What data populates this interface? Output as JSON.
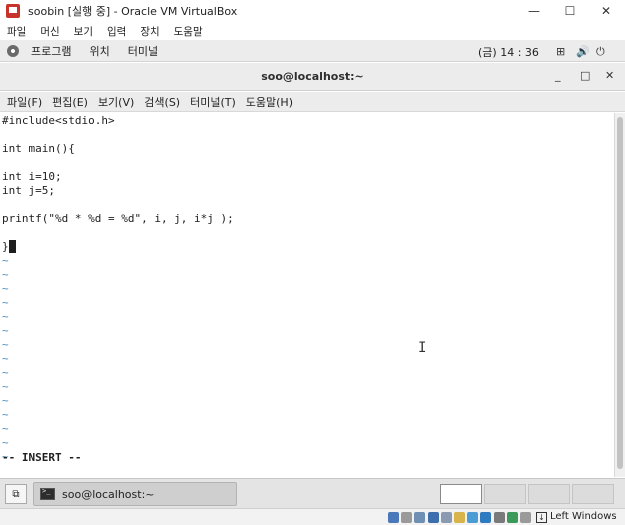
{
  "vbox": {
    "window_title": "soobin [실행 중] - Oracle VM VirtualBox",
    "minimize_glyph": "—",
    "maximize_glyph": "☐",
    "close_glyph": "✕",
    "menu": [
      "파일",
      "머신",
      "보기",
      "입력",
      "장치",
      "도움말"
    ],
    "host_key_label": "Left Windows",
    "status_icons": [
      {
        "name": "hard-disk-icon",
        "color": "#4a78b8"
      },
      {
        "name": "optical-drive-icon",
        "color": "#9a9a9a"
      },
      {
        "name": "audio-icon",
        "color": "#6f8fb3"
      },
      {
        "name": "network-icon",
        "color": "#3d6fae"
      },
      {
        "name": "usb-icon",
        "color": "#8a9ab0"
      },
      {
        "name": "shared-folders-icon",
        "color": "#d8b44a"
      },
      {
        "name": "capture-icon",
        "color": "#4b9bd4"
      },
      {
        "name": "display-icon",
        "color": "#2f7bc0"
      },
      {
        "name": "video-capture-icon",
        "color": "#7a7a7a"
      },
      {
        "name": "cpu-icon",
        "color": "#3b9a5a"
      },
      {
        "name": "mouse-integration-icon",
        "color": "#9a9a9a"
      }
    ]
  },
  "gnome": {
    "panel_items": [
      "프로그램",
      "위치",
      "터미널"
    ],
    "clock": "(금) 14 : 36",
    "network_glyph": "⊞",
    "volume_glyph": "🔊",
    "power_glyph": "⏻"
  },
  "terminal": {
    "title": "soo@localhost:~",
    "minimize_glyph": "_",
    "maximize_glyph": "□",
    "close_glyph": "✕",
    "menu": [
      "파일(F)",
      "편집(E)",
      "보기(V)",
      "검색(S)",
      "터미널(T)",
      "도움말(H)"
    ],
    "lines": [
      "#include<stdio.h>",
      "",
      "int main(){",
      "",
      "int i=10;",
      "int j=5;",
      "",
      "printf(\"%d * %d = %d\", i, j, i*j );",
      "",
      "}"
    ],
    "tilde": "~",
    "tilde_count": 15,
    "mode_line": "-- INSERT --",
    "text_color": "#1e1e1e",
    "tilde_color": "#4a90c0"
  },
  "taskbar": {
    "show_desktop_glyph": "⧉",
    "task_label": "soo@localhost:~",
    "workspace_count": 4,
    "active_workspace": 1
  }
}
